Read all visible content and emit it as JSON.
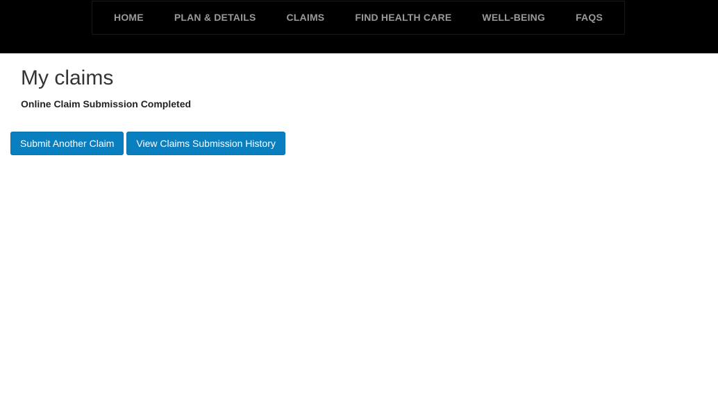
{
  "nav": {
    "items": [
      {
        "label": "HOME"
      },
      {
        "label": "PLAN & DETAILS"
      },
      {
        "label": "CLAIMS"
      },
      {
        "label": "FIND HEALTH CARE"
      },
      {
        "label": "WELL-BEING"
      },
      {
        "label": "FAQS"
      }
    ]
  },
  "main": {
    "title": "My claims",
    "status": "Online Claim Submission Completed",
    "buttons": {
      "submit_another": "Submit Another Claim",
      "view_history": "View Claims Submission History"
    }
  },
  "colors": {
    "header_bg": "#000000",
    "nav_text": "#9a9a9a",
    "button_bg": "#0a7fc0",
    "button_text": "#ffffff"
  }
}
